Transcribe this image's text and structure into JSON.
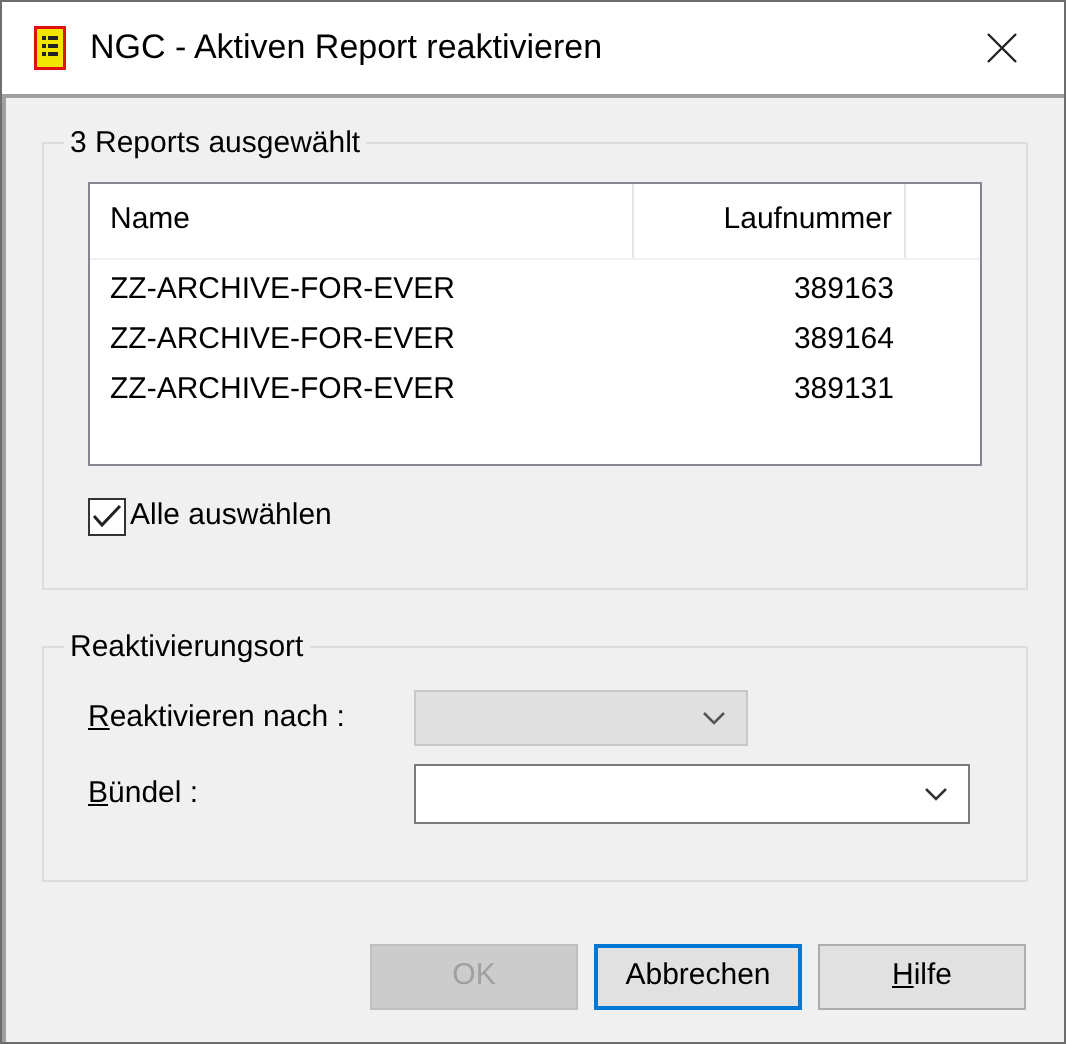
{
  "window": {
    "title": "NGC - Aktiven Report reaktivieren"
  },
  "selection_group": {
    "title": "3 Reports ausgewählt",
    "table": {
      "columns": [
        "Name",
        "Laufnummer"
      ],
      "rows": [
        {
          "cells": [
            "ZZ-ARCHIVE-FOR-EVER",
            "389163"
          ],
          "selected": false
        },
        {
          "cells": [
            "ZZ-ARCHIVE-FOR-EVER",
            "389164"
          ],
          "selected": false
        },
        {
          "cells": [
            "ZZ-ARCHIVE-FOR-EVER",
            "389131"
          ],
          "selected": false
        }
      ]
    },
    "select_all": {
      "label": "Alle auswählen",
      "checked": true
    }
  },
  "location_group": {
    "title": "Reaktivierungsort",
    "fields": [
      {
        "label": "Reaktivieren nach :",
        "mnemonic_first": true,
        "disabled": true
      },
      {
        "label": "Bündel :",
        "mnemonic_first": true,
        "disabled": false
      }
    ]
  },
  "buttons": [
    {
      "label": "OK",
      "disabled": true,
      "default": false,
      "mnemonic_first": false
    },
    {
      "label": "Abbrechen",
      "disabled": false,
      "default": true,
      "mnemonic_first": false
    },
    {
      "label": "Hilfe",
      "disabled": false,
      "default": false,
      "mnemonic_first": true
    }
  ]
}
